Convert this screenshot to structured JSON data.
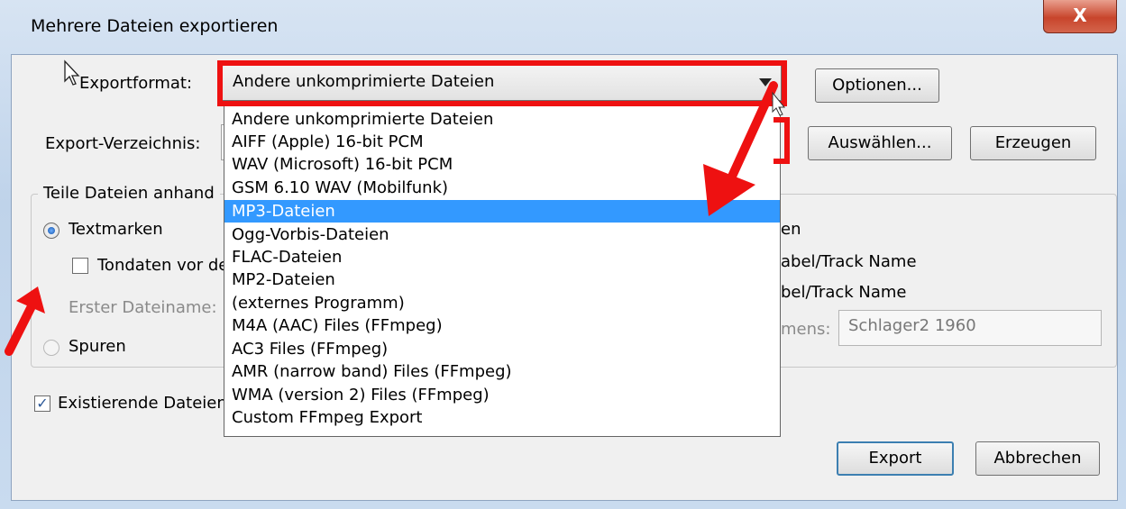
{
  "window": {
    "title": "Mehrere Dateien exportieren",
    "close_label": "X"
  },
  "format": {
    "label": "Exportformat:",
    "selected": "Andere unkomprimierte Dateien",
    "options_button": "Optionen..."
  },
  "directory": {
    "label": "Export-Verzeichnis:",
    "choose_button": "Auswählen...",
    "create_button": "Erzeugen"
  },
  "split": {
    "group_title": "Teile Dateien anhand",
    "labels_radio": "Textmarken",
    "include_audio_checkbox": "Tondaten vor de",
    "first_filename_label": "Erster Dateiname:",
    "tracks_radio": "Spuren",
    "naming_header_partial": "en",
    "naming_option1_partial": "abel/Track Name",
    "naming_option2_partial": "bel/Track Name",
    "prefix_label_partial": "mens:",
    "prefix_value": "Schlager2 1960"
  },
  "overwrite_checkbox": "Existierende Dateien",
  "dropdown": {
    "items": [
      "Andere unkomprimierte Dateien",
      "AIFF (Apple) 16-bit PCM",
      "WAV (Microsoft) 16-bit PCM",
      "GSM 6.10 WAV (Mobilfunk)",
      "MP3-Dateien",
      "Ogg-Vorbis-Dateien",
      "FLAC-Dateien",
      "MP2-Dateien",
      "(externes Programm)",
      "M4A (AAC) Files (FFmpeg)",
      "AC3 Files (FFmpeg)",
      "AMR (narrow band) Files (FFmpeg)",
      "WMA (version 2) Files (FFmpeg)",
      "Custom FFmpeg Export"
    ],
    "selected_index": 4
  },
  "buttons": {
    "export": "Export",
    "cancel": "Abbrechen"
  },
  "colors": {
    "annotation_red": "#ee1111",
    "selection_blue": "#3399ff"
  }
}
